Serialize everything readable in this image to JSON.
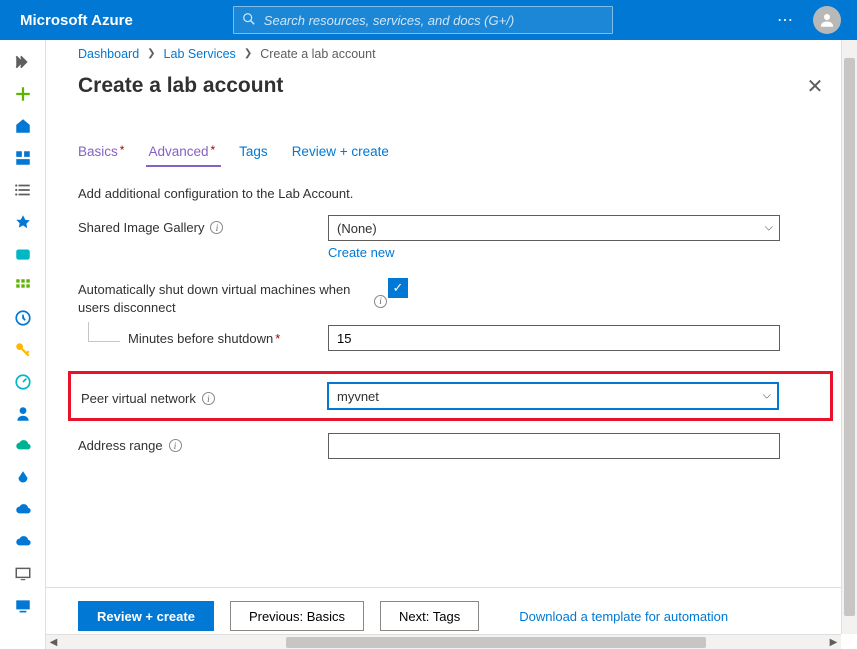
{
  "brand": "Microsoft Azure",
  "search": {
    "placeholder": "Search resources, services, and docs (G+/)"
  },
  "breadcrumb": {
    "items": [
      "Dashboard",
      "Lab Services"
    ],
    "current": "Create a lab account"
  },
  "page": {
    "title": "Create a lab account"
  },
  "tabs": {
    "basics": "Basics",
    "advanced": "Advanced",
    "tags": "Tags",
    "review": "Review + create"
  },
  "form": {
    "description": "Add additional configuration to the Lab Account.",
    "shared_gallery_label": "Shared Image Gallery",
    "shared_gallery_value": "(None)",
    "create_new": "Create new",
    "auto_shutdown_label": "Automatically shut down virtual machines when users disconnect",
    "minutes_label": "Minutes before shutdown",
    "minutes_value": "15",
    "peer_vnet_label": "Peer virtual network",
    "peer_vnet_value": "myvnet",
    "address_range_label": "Address range",
    "address_range_value": ""
  },
  "footer": {
    "review": "Review + create",
    "previous": "Previous: Basics",
    "next": "Next: Tags",
    "download": "Download a template for automation"
  }
}
